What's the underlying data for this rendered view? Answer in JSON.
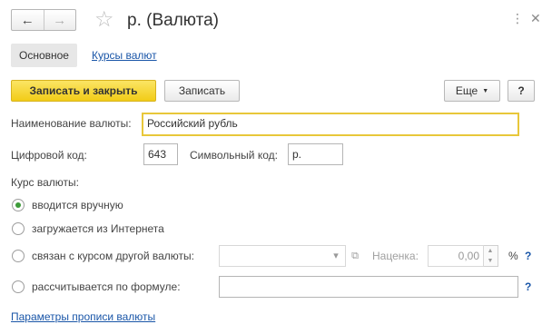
{
  "nav": {
    "back_icon": "←",
    "forward_icon": "→"
  },
  "window": {
    "title": "р. (Валюта)",
    "star_icon": "☆",
    "menu_icon": "⋮",
    "close_icon": "✕"
  },
  "tabs": {
    "main_label": "Основное",
    "rates_link": "Курсы валют"
  },
  "toolbar": {
    "save_close_label": "Записать и закрыть",
    "save_label": "Записать",
    "more_label": "Еще",
    "more_caret": "▼",
    "help_label": "?"
  },
  "form": {
    "name_label": "Наименование валюты:",
    "name_value": "Российский рубль",
    "digital_code_label": "Цифровой код:",
    "digital_code_value": "643",
    "symbol_code_label": "Символьный код:",
    "symbol_code_value": "р.",
    "rate_section_label": "Курс валюты:",
    "rate_options": [
      {
        "label": "вводится вручную",
        "checked": true
      },
      {
        "label": "загружается из Интернета",
        "checked": false
      },
      {
        "label": "связан с курсом другой валюты:",
        "checked": false
      },
      {
        "label": "рассчитывается по формуле:",
        "checked": false
      }
    ],
    "linked_currency_value": "",
    "dropdown_icon": "▾",
    "open_icon": "⧉",
    "markup_label": "Наценка:",
    "markup_value": "0,00",
    "spin_up": "▲",
    "spin_down": "▼",
    "percent_label": "%",
    "formula_value": "",
    "help_mark": "?",
    "spelling_params_link": "Параметры прописи валюты"
  },
  "colors": {
    "accent_yellow": "#f5d020",
    "link_blue": "#1a56a8",
    "radio_green": "#3d9b39"
  }
}
